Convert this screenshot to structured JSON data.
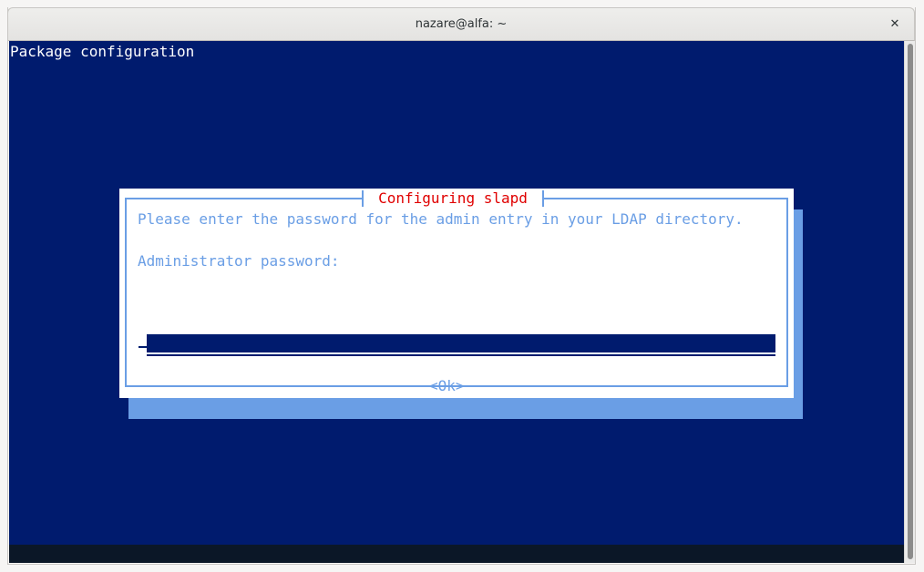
{
  "window": {
    "title": "nazare@alfa: ~",
    "close_icon": "close-icon",
    "close_glyph": "✕"
  },
  "terminal": {
    "header": "Package configuration",
    "colors": {
      "background": "#001b6e",
      "dialog_accent": "#6a9ee5",
      "dialog_title": "#e00000",
      "dialog_bg": "#ffffff"
    }
  },
  "dialog": {
    "title": "Configuring slapd",
    "prompt": "Please enter the password for the admin entry in your LDAP directory.",
    "field_label": "Administrator password:",
    "password_value": "",
    "ok_label": "<Ok>"
  }
}
